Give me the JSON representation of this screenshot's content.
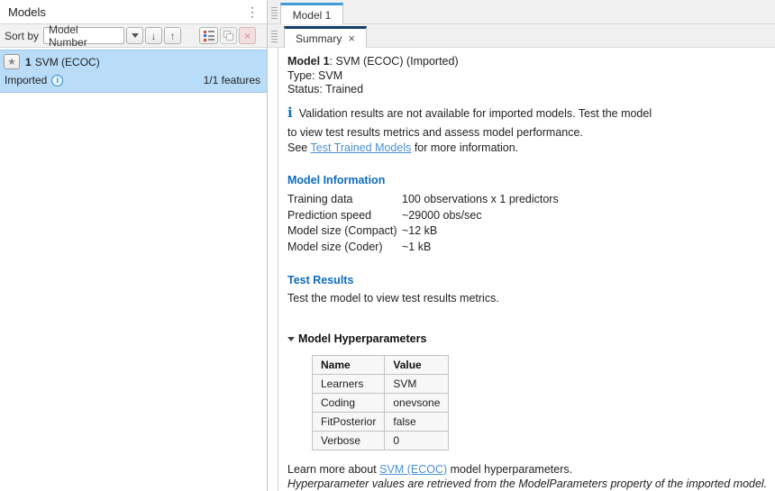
{
  "colors": {
    "selection_blue": "#b9dcf8",
    "heading_blue": "#0d6cbd",
    "link_blue": "#4a90d2",
    "model_tab_accent": "#3f9bdc",
    "summary_tab_accent": "#123f66",
    "info_icon_blue": "#1771b7"
  },
  "left_panel": {
    "title": "Models",
    "sort_label": "Sort by",
    "sort_value": "Model Number",
    "model": {
      "number": "1",
      "name": "SVM (ECOC)",
      "status": "Imported",
      "features": "1/1 features",
      "star_glyph": "★",
      "info_glyph": "i"
    },
    "kebab_glyph": "⋮",
    "sort_desc_glyph": "↓",
    "sort_asc_glyph": "↑",
    "delete_glyph": "×"
  },
  "tabs": {
    "document_tab": "Model 1",
    "view_tab": "Summary",
    "close_glyph": "×"
  },
  "summary": {
    "title_bold": "Model 1",
    "title_rest": ": SVM (ECOC) (Imported)",
    "type_line": "Type: SVM",
    "status_line": "Status: Trained",
    "info_icon_glyph": "i",
    "notice_line1": "Validation results are not available for imported models. Test the model",
    "notice_line2": "to view test results metrics and assess model performance.",
    "notice_line3_pre": "See ",
    "notice_link": "Test Trained Models",
    "notice_line3_post": " for more information.",
    "model_info": {
      "heading": "Model Information",
      "rows": [
        {
          "label": "Training data",
          "value": "100 observations x 1 predictors"
        },
        {
          "label": "Prediction speed",
          "value": "~29000 obs/sec"
        },
        {
          "label": "Model size (Compact)",
          "value": "~12 kB"
        },
        {
          "label": "Model size (Coder)",
          "value": "~1 kB"
        }
      ]
    },
    "test_results": {
      "heading": "Test Results",
      "body": "Test the model to view test results metrics."
    },
    "hyperparameters": {
      "heading": "Model Hyperparameters",
      "table": {
        "headers": [
          "Name",
          "Value"
        ],
        "rows": [
          [
            "Learners",
            "SVM"
          ],
          [
            "Coding",
            "onevsone"
          ],
          [
            "FitPosterior",
            "false"
          ],
          [
            "Verbose",
            "0"
          ]
        ]
      },
      "learn_pre": "Learn more about ",
      "learn_link": "SVM (ECOC)",
      "learn_post": " model hyperparameters.",
      "footnote": "Hyperparameter values are retrieved from the ModelParameters property of the imported model."
    }
  }
}
